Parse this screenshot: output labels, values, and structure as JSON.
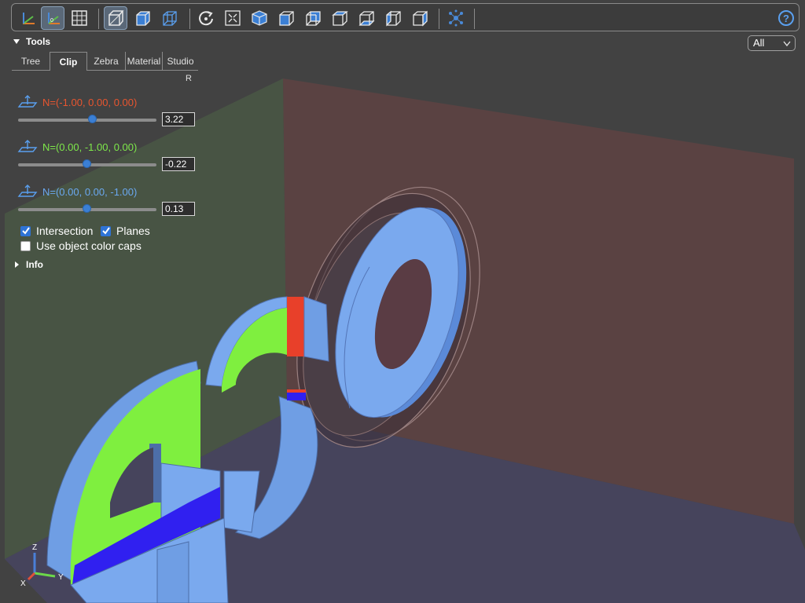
{
  "toolbar": {
    "buttons": [
      {
        "name": "axes-button",
        "icon": "axes-icon",
        "active": false
      },
      {
        "name": "axes-origin-button",
        "icon": "axes-origin-icon",
        "active": true
      },
      {
        "name": "grid-button",
        "icon": "grid-icon",
        "active": false
      },
      {
        "name": "perspective-button",
        "icon": "perspective-cube-icon",
        "active": true
      },
      {
        "name": "ortho-button",
        "icon": "ortho-cube-icon",
        "active": false
      },
      {
        "name": "transparent-button",
        "icon": "transparent-cube-icon",
        "active": false
      },
      {
        "name": "reset-view-button",
        "icon": "reset-icon",
        "active": false
      },
      {
        "name": "fit-view-button",
        "icon": "fit-icon",
        "active": false
      },
      {
        "name": "iso-view-button",
        "icon": "iso-cube-icon",
        "active": false
      },
      {
        "name": "front-view-button",
        "icon": "front-cube-icon",
        "active": false
      },
      {
        "name": "rear-view-button",
        "icon": "rear-cube-icon",
        "active": false
      },
      {
        "name": "top-view-button",
        "icon": "top-cube-icon",
        "active": false
      },
      {
        "name": "bottom-view-button",
        "icon": "bottom-cube-icon",
        "active": false
      },
      {
        "name": "left-view-button",
        "icon": "left-cube-icon",
        "active": false
      },
      {
        "name": "right-view-button",
        "icon": "right-cube-icon",
        "active": false
      },
      {
        "name": "explode-button",
        "icon": "explode-icon",
        "active": false
      }
    ],
    "help_icon": "help-icon"
  },
  "tools": {
    "title": "Tools",
    "tabs": [
      "Tree",
      "Clip",
      "Zebra",
      "Material",
      "Studio"
    ],
    "selected_tab": "Clip",
    "reset_label": "R",
    "clips": [
      {
        "label": "N=(-1.00, 0.00, 0.00)",
        "value": "3.22",
        "color": "#e8552f",
        "slider": 0.54
      },
      {
        "label": "N=(0.00, -1.00, 0.00)",
        "value": "-0.22",
        "color": "#7ee84a",
        "slider": 0.5
      },
      {
        "label": "N=(0.00, 0.00, -1.00)",
        "value": "0.13",
        "color": "#6aa8f0",
        "slider": 0.5
      }
    ],
    "intersection_label": "Intersection",
    "planes_label": "Planes",
    "object_color_caps_label": "Use object color caps",
    "info_title": "Info"
  },
  "view_filter": {
    "value": "All"
  },
  "orientation_axes": {
    "x": "X",
    "y": "Y",
    "z": "Z"
  }
}
